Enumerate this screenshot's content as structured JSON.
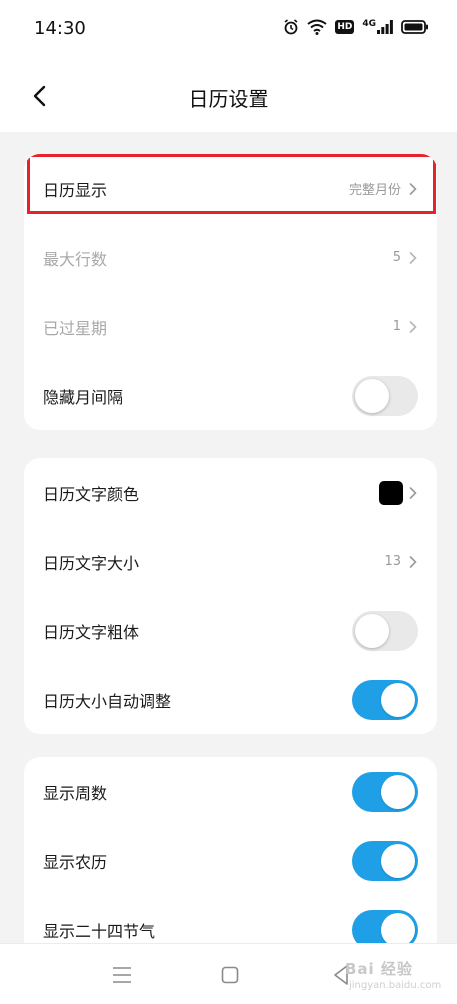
{
  "status_bar": {
    "time": "14:30",
    "hd_label": "HD",
    "network_label": "4G",
    "icons": [
      "alarm-icon",
      "wifi-icon",
      "hd-icon",
      "signal-icon",
      "battery-icon"
    ]
  },
  "header": {
    "title": "日历设置",
    "back_icon": "chevron-left-icon"
  },
  "colors": {
    "accent": "#1e9fe6",
    "highlight": "#e5232a",
    "background": "#f3f3f3"
  },
  "card1": {
    "calendar_display": {
      "label": "日历显示",
      "value": "完整月份"
    },
    "max_rows": {
      "label": "最大行数",
      "value": "5"
    },
    "past_weeks": {
      "label": "已过星期",
      "value": "1"
    },
    "hide_month_gap": {
      "label": "隐藏月间隔",
      "on": false
    }
  },
  "card2": {
    "text_color": {
      "label": "日历文字颜色",
      "color": "#000000"
    },
    "text_size": {
      "label": "日历文字大小",
      "value": "13"
    },
    "text_bold": {
      "label": "日历文字粗体",
      "on": false
    },
    "auto_size": {
      "label": "日历大小自动调整",
      "on": true
    }
  },
  "card3": {
    "show_week_number": {
      "label": "显示周数",
      "on": true
    },
    "show_lunar": {
      "label": "显示农历",
      "on": true
    },
    "show_solar_terms": {
      "label": "显示二十四节气",
      "on": true
    }
  },
  "nav_bar": {
    "icons": [
      "menu-icon",
      "home-icon",
      "back-icon"
    ],
    "watermark": "Bai 经验",
    "watermark_sub": "jingyan.baidu.com"
  }
}
